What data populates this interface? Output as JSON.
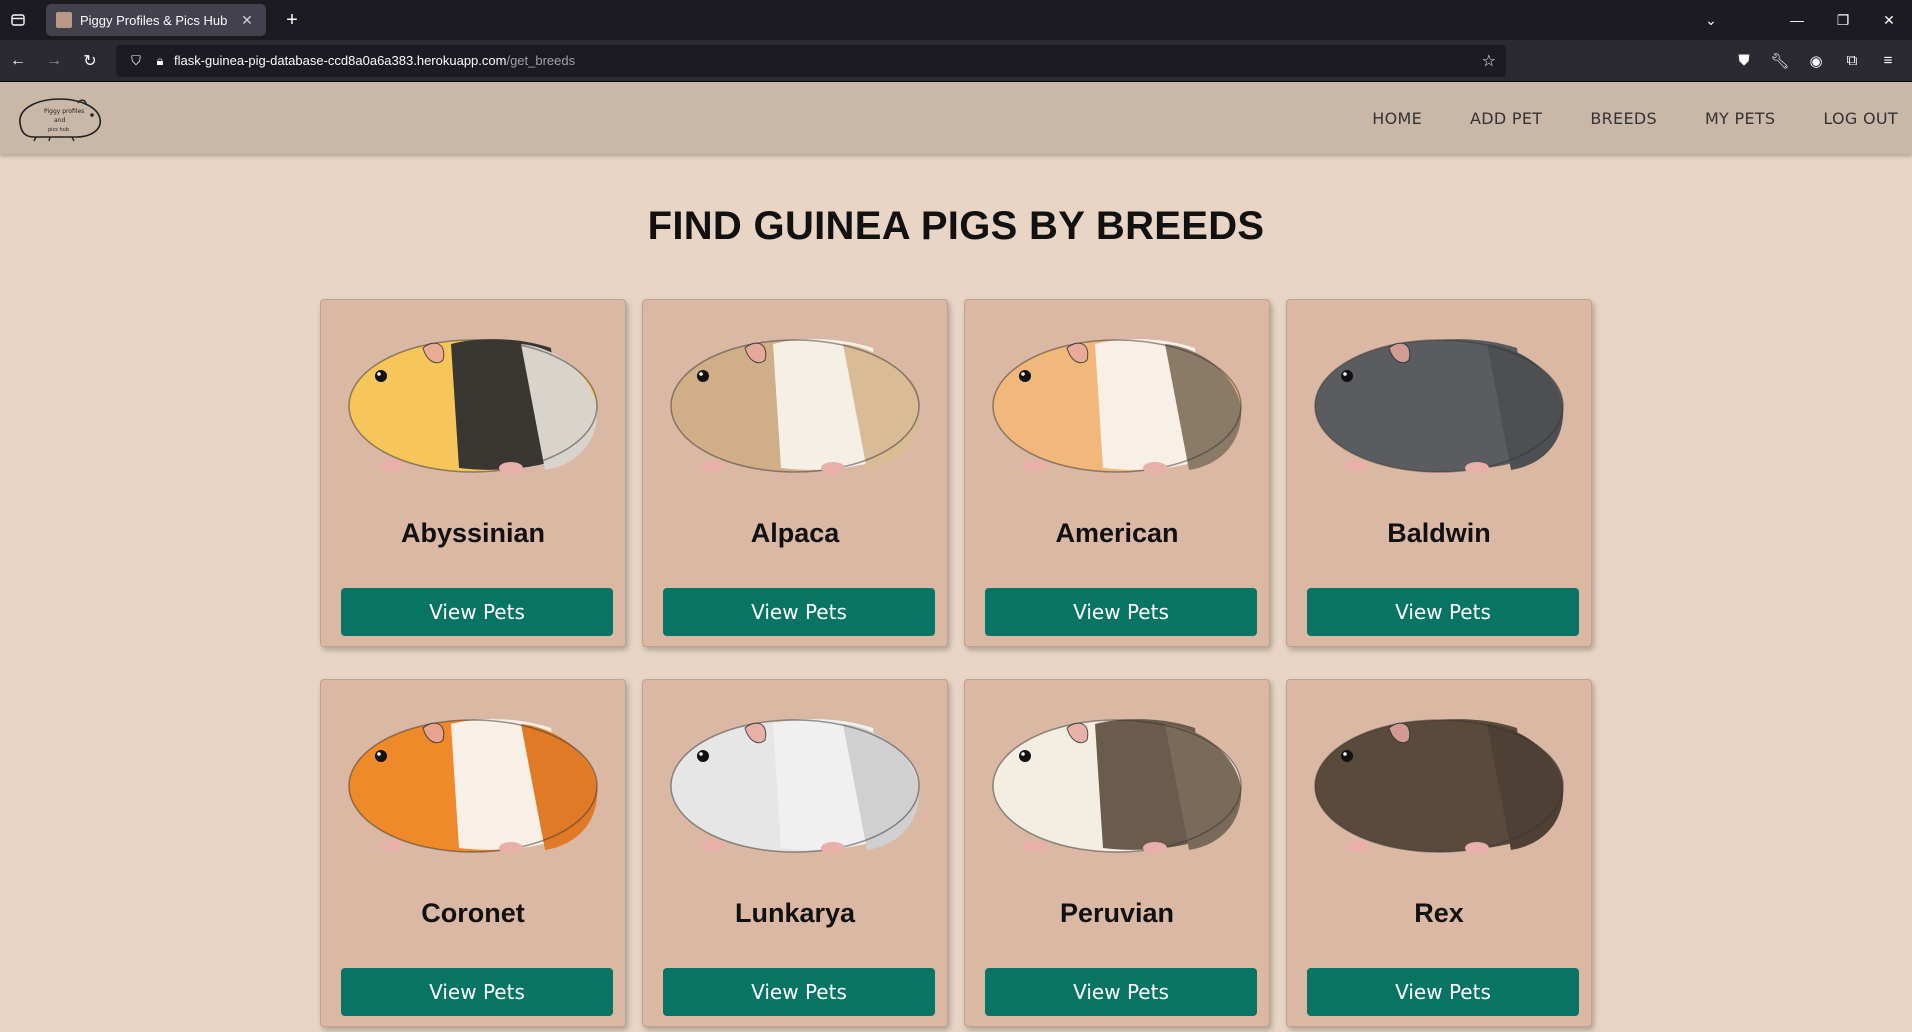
{
  "browser": {
    "tab_title": "Piggy Profiles & Pics Hub",
    "url_host": "flask-guinea-pig-database-ccd8a0a6a383.herokuapp.com",
    "url_path": "/get_breeds"
  },
  "site": {
    "logo_text_top": "Piggy profiles",
    "logo_text_mid": "and",
    "logo_text_bottom": "pics hub",
    "nav": [
      "HOME",
      "ADD PET",
      "BREEDS",
      "MY PETS",
      "LOG OUT"
    ]
  },
  "page": {
    "title": "FIND GUINEA PIGS BY BREEDS"
  },
  "breeds": [
    {
      "name": "Abyssinian",
      "button": "View Pets",
      "colors": [
        "#f6c65a",
        "#3a3733",
        "#d8d4cc"
      ]
    },
    {
      "name": "Alpaca",
      "button": "View Pets",
      "colors": [
        "#cfae88",
        "#f5efe6",
        "#d9bb96"
      ]
    },
    {
      "name": "American",
      "button": "View Pets",
      "colors": [
        "#f2b77a",
        "#f8efe6",
        "#8a7a66"
      ]
    },
    {
      "name": "Baldwin",
      "button": "View Pets",
      "colors": [
        "#5a5c60",
        "#5a5c60",
        "#4d4f53"
      ]
    },
    {
      "name": "Coronet",
      "button": "View Pets",
      "colors": [
        "#ef8a2a",
        "#f8efe6",
        "#e07a26"
      ]
    },
    {
      "name": "Lunkarya",
      "button": "View Pets",
      "colors": [
        "#e6e6e6",
        "#f0f0f0",
        "#d0d0d0"
      ]
    },
    {
      "name": "Peruvian",
      "button": "View Pets",
      "colors": [
        "#f4ede2",
        "#6a5b4c",
        "#7a6a5a"
      ]
    },
    {
      "name": "Rex",
      "button": "View Pets",
      "colors": [
        "#5a4a3c",
        "#5a4a3c",
        "#4e4034"
      ]
    }
  ],
  "colors": {
    "page_bg": "#e8d5c5",
    "header_bg": "#c9b8a8",
    "card_bg": "#dbb8a4",
    "button_bg": "#087463"
  }
}
